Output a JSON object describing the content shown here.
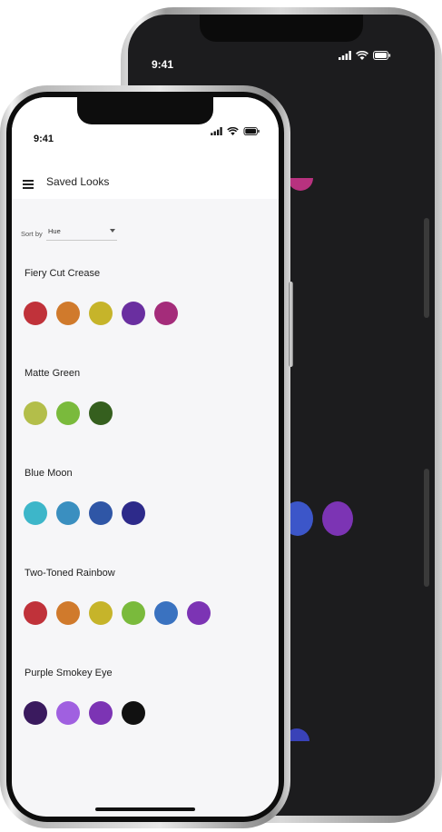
{
  "back_phone": {
    "status_time": "9:41",
    "visible_dots": [
      "#b8327f",
      "#3c56c9",
      "#7c34b4",
      "#3942b8"
    ]
  },
  "front_phone": {
    "status_time": "9:41",
    "status_icons": [
      "cellular-signal-icon",
      "wifi-icon",
      "battery-icon"
    ],
    "header": {
      "title": "Saved Looks",
      "menu_icon": "hamburger-menu-icon"
    },
    "sort": {
      "label": "Sort by",
      "value": "Hue"
    },
    "looks": [
      {
        "name": "Fiery Cut Crease",
        "colors": [
          "#c0323a",
          "#d07a2c",
          "#c6b42a",
          "#6a2fa0",
          "#a42c7a"
        ]
      },
      {
        "name": "Matte Green",
        "colors": [
          "#b3be4a",
          "#7aba3c",
          "#355f1e"
        ]
      },
      {
        "name": "Blue Moon",
        "colors": [
          "#3db6c9",
          "#3a8fc0",
          "#2f56a6",
          "#2d2a8a"
        ]
      },
      {
        "name": "Two-Toned Rainbow",
        "colors": [
          "#c0323a",
          "#d07a2c",
          "#c6b42a",
          "#7aba3c",
          "#3a72c0",
          "#7c34b4"
        ]
      },
      {
        "name": "Purple Smokey Eye",
        "colors": [
          "#3a1a5e",
          "#a060e0",
          "#7c34b4",
          "#111111"
        ]
      }
    ]
  }
}
